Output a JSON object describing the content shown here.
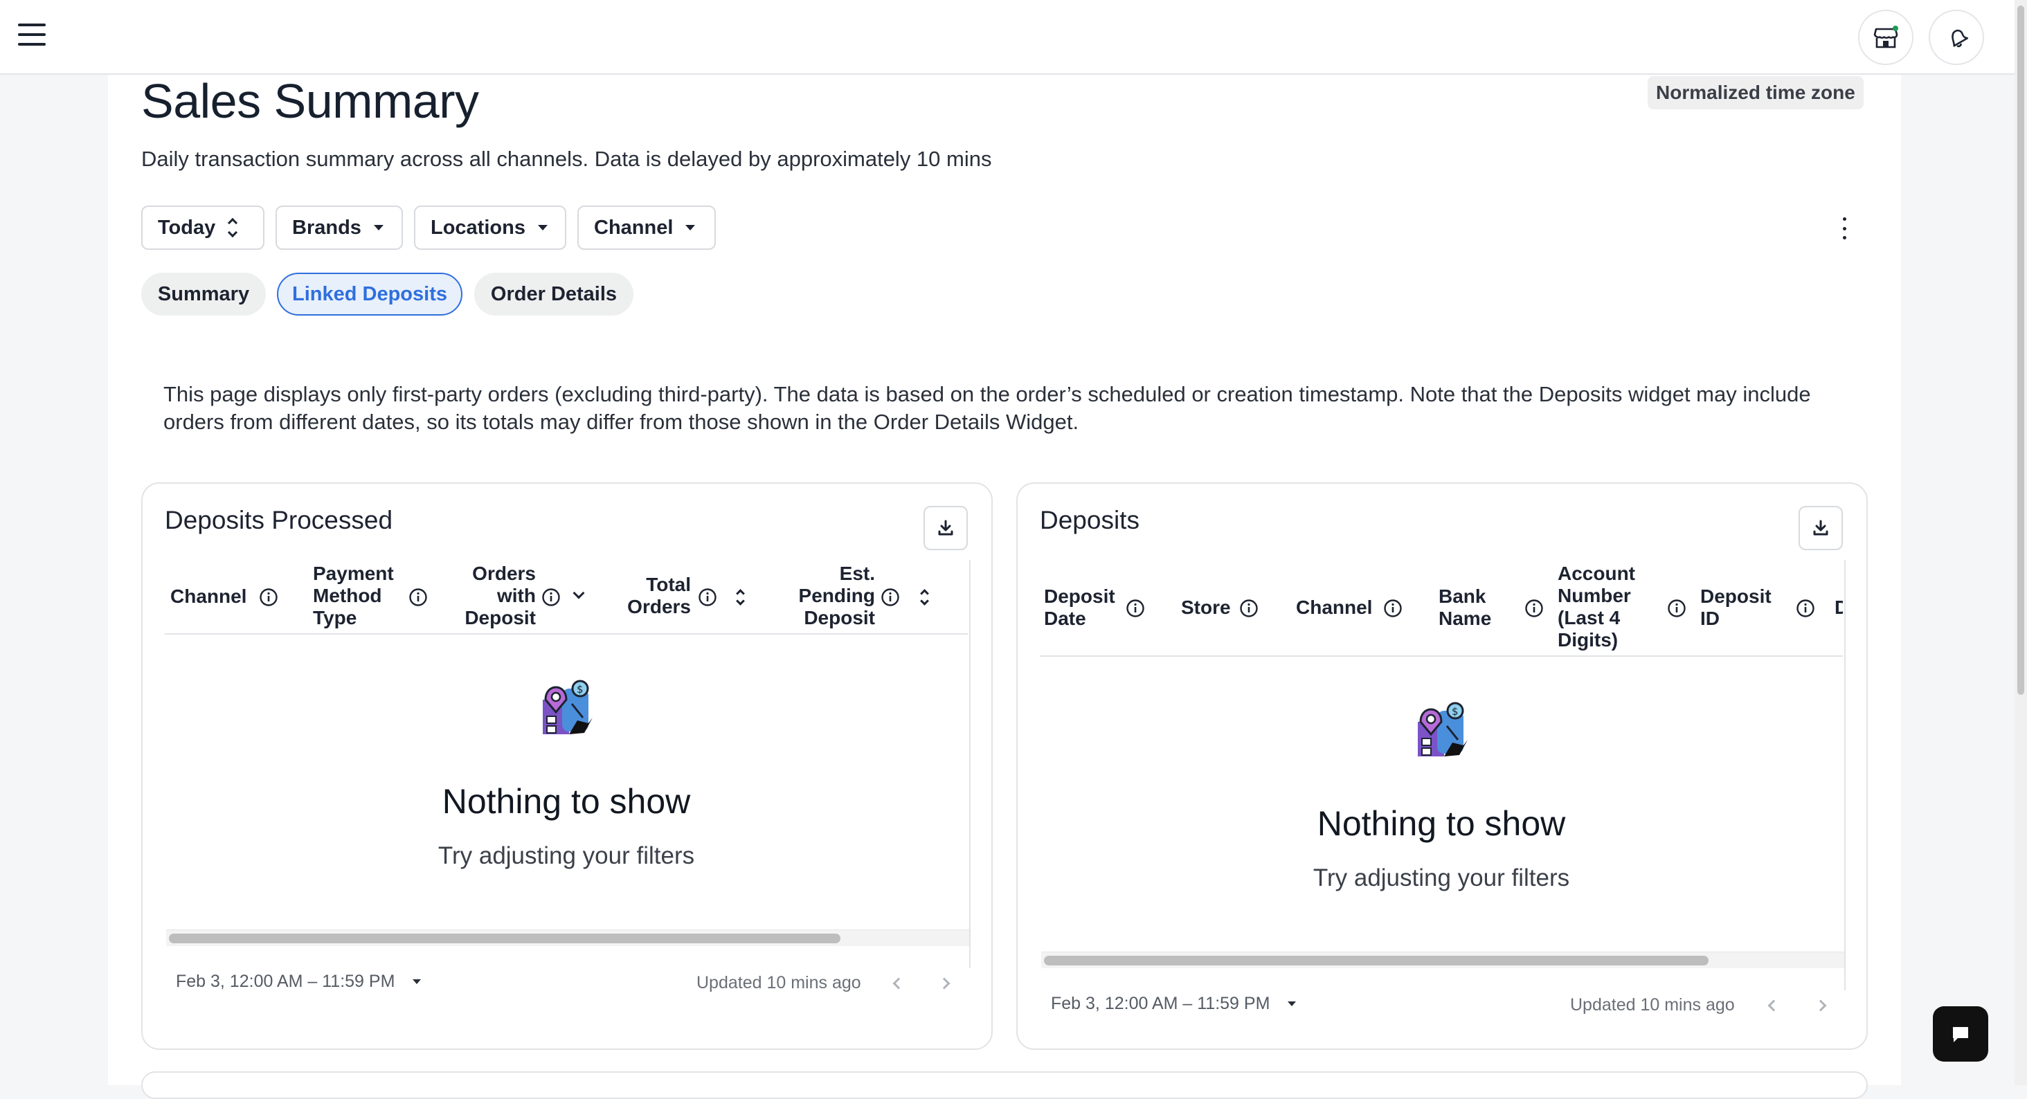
{
  "header": {
    "menu_icon": "hamburger-icon",
    "store_icon": "storefront-icon",
    "notification_icon": "bell-icon"
  },
  "page": {
    "title": "Sales Summary",
    "subtitle": "Daily transaction summary across all channels. Data is delayed by approximately 10 mins",
    "timezone_badge": "Normalized time zone"
  },
  "filters": {
    "date": "Today",
    "brands": "Brands",
    "locations": "Locations",
    "channel": "Channel"
  },
  "tabs": [
    {
      "label": "Summary",
      "active": false
    },
    {
      "label": "Linked Deposits",
      "active": true
    },
    {
      "label": "Order Details",
      "active": false
    }
  ],
  "notice": "This page displays only first-party orders (excluding third-party). The data is based on the order’s scheduled or creation timestamp. Note that the Deposits widget may include orders from different dates, so its totals may differ from those shown in the Order Details Widget.",
  "deposits_processed": {
    "title": "Deposits Processed",
    "columns": {
      "channel": "Channel",
      "payment_method": [
        "Payment",
        "Method",
        "Type"
      ],
      "orders_with_deposit": [
        "Orders",
        "with",
        "Deposit"
      ],
      "total_orders": [
        "Total",
        "Orders"
      ],
      "est_pending": [
        "Est.",
        "Pending",
        "Deposit"
      ]
    },
    "empty_title": "Nothing to show",
    "empty_sub": "Try adjusting your filters",
    "date_range": "Feb 3, 12:00 AM – 11:59 PM",
    "updated": "Updated 10 mins ago"
  },
  "deposits": {
    "title": "Deposits",
    "columns": {
      "deposit_date": [
        "Deposit",
        "Date"
      ],
      "store": "Store",
      "channel": "Channel",
      "bank_name": [
        "Bank",
        "Name"
      ],
      "account_number": [
        "Account",
        "Number",
        "(Last 4",
        "Digits)"
      ],
      "deposit_id": [
        "Deposit",
        "ID"
      ],
      "truncated": "D"
    },
    "empty_title": "Nothing to show",
    "empty_sub": "Try adjusting your filters",
    "date_range": "Feb 3, 12:00 AM – 11:59 PM",
    "updated": "Updated 10 mins ago"
  },
  "colors": {
    "accent": "#2f6fdd",
    "text": "#1d2330",
    "border": "#e1e3e6",
    "chat_button": "#111111"
  }
}
